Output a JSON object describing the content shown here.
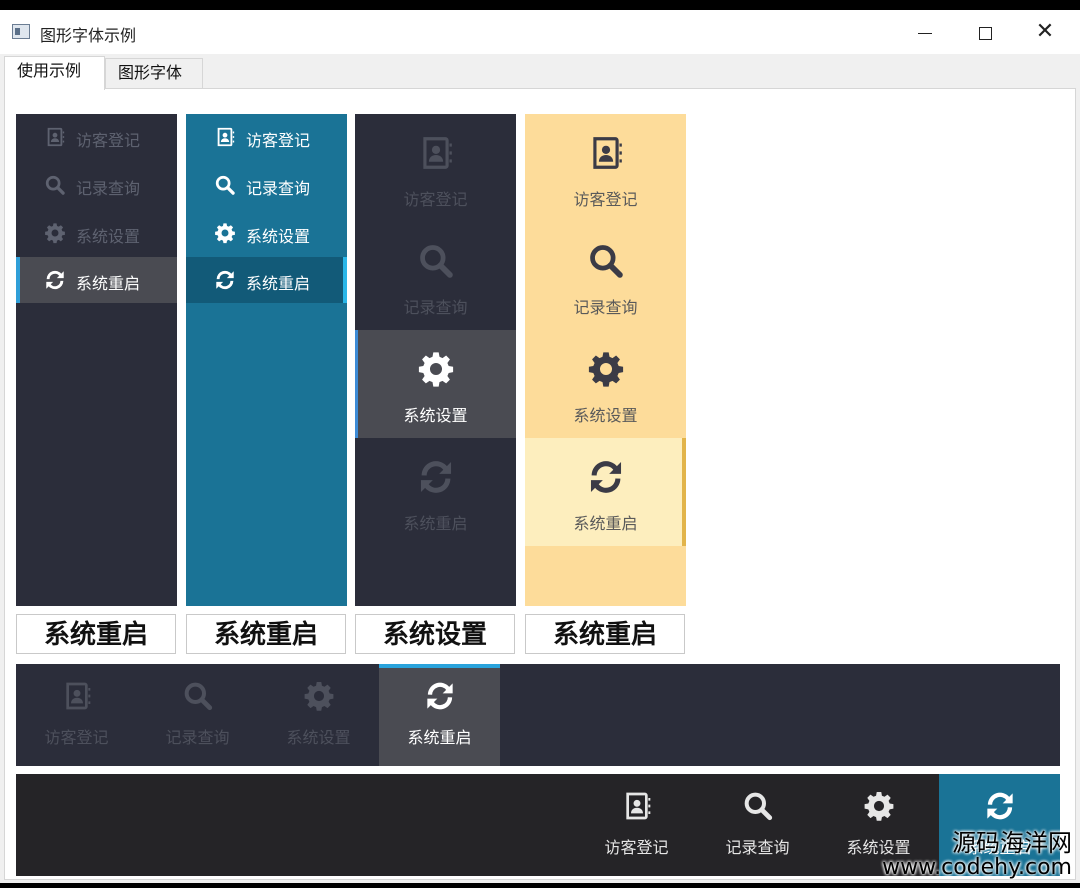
{
  "window": {
    "title": "图形字体示例",
    "icon": "app-window-icon",
    "controls": {
      "minimize": "minimize-icon",
      "maximize": "maximize-icon",
      "close": "✕"
    }
  },
  "tabs": [
    {
      "label": "使用示例",
      "selected": true
    },
    {
      "label": "图形字体",
      "selected": false
    }
  ],
  "nav_items": [
    "访客登记",
    "记录查询",
    "系统设置",
    "系统重启"
  ],
  "nav_icons": [
    "contact-book-icon",
    "search-icon",
    "gear-icon",
    "refresh-icon"
  ],
  "panels": [
    {
      "style": "dark",
      "active_index": 3,
      "accent": "#2f9fd8"
    },
    {
      "style": "blue",
      "active_index": 3,
      "accent": "#29b6e8"
    },
    {
      "style": "dark-large",
      "active_index": 2,
      "accent": "#3d8bd6"
    },
    {
      "style": "yellow",
      "active_index": 3,
      "accent": "#e2b44a"
    }
  ],
  "selected_labels": [
    "系统重启",
    "系统重启",
    "系统设置",
    "系统重启"
  ],
  "horizontal_bars": [
    {
      "style": "dark",
      "active_index": 3,
      "accent": "#29a3dc"
    },
    {
      "style": "black",
      "active_index": 3,
      "accent": "#1a7396"
    }
  ],
  "watermark": {
    "line1": "源码海洋网",
    "line2": "www.codehy.com"
  }
}
